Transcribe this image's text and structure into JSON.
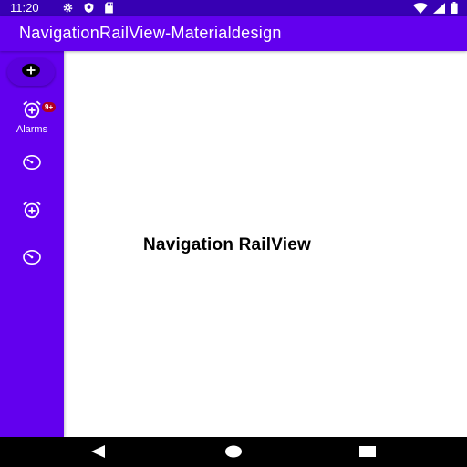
{
  "status_bar": {
    "time": "11:20",
    "left_icons": [
      "gear-icon",
      "shield-icon",
      "sd-card-icon"
    ],
    "right_icons": [
      "wifi-icon",
      "signal-icon",
      "battery-icon"
    ]
  },
  "app_bar": {
    "title": "NavigationRailView-Materialdesign"
  },
  "rail": {
    "fab_icon": "add-icon",
    "items": [
      {
        "icon": "alarm-add-icon",
        "label": "Alarms",
        "badge": "9+",
        "selected": true
      },
      {
        "icon": "timer-icon",
        "label": "",
        "badge": ""
      },
      {
        "icon": "alarm-add-icon",
        "label": "",
        "badge": ""
      },
      {
        "icon": "timer-icon",
        "label": "",
        "badge": ""
      }
    ]
  },
  "content": {
    "text": "Navigation RailView"
  },
  "nav_bar": {
    "buttons": [
      "back-icon",
      "home-icon",
      "recents-icon"
    ]
  },
  "colors": {
    "primary": "#6200ee",
    "primary_dark": "#3700b3",
    "badge": "#b00020"
  }
}
